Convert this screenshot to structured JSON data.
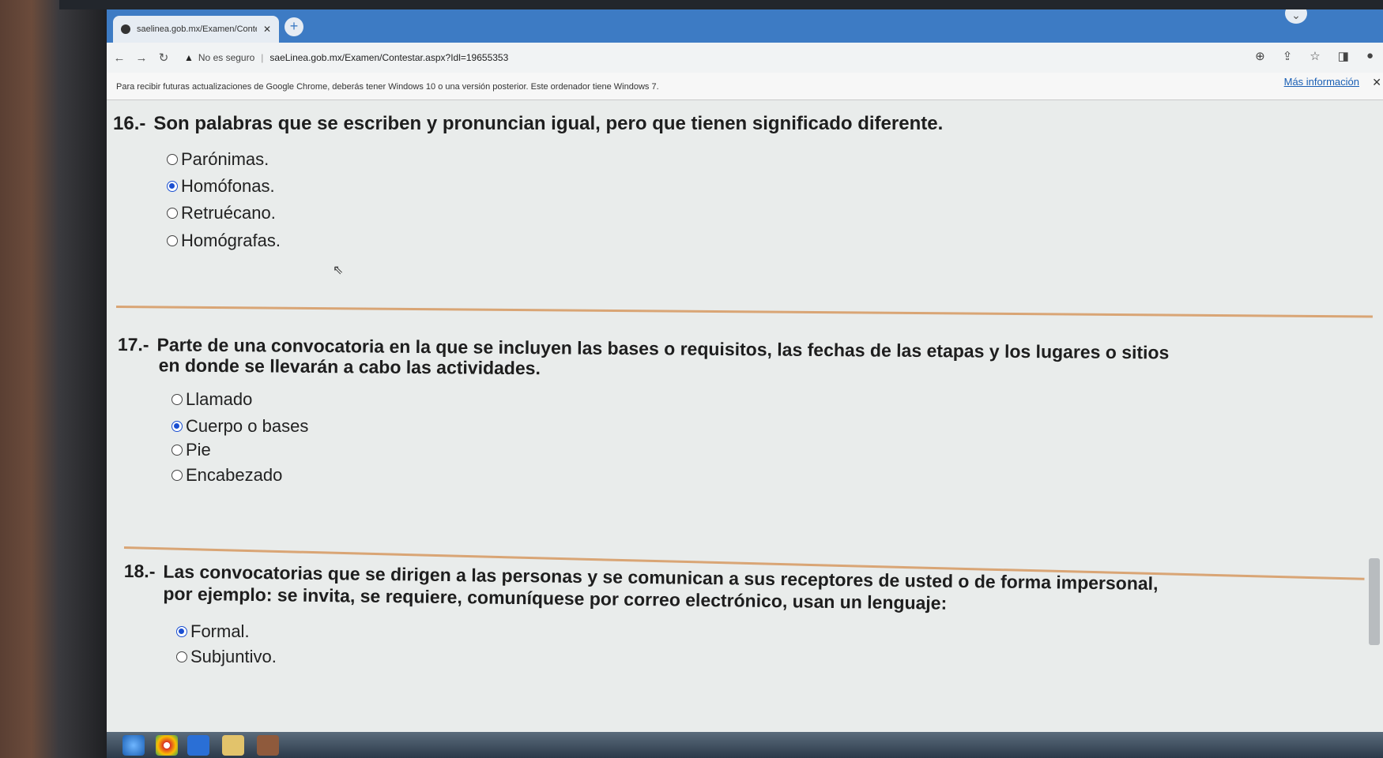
{
  "browser": {
    "tab_title": "saelinea.gob.mx/Examen/Conte",
    "insecure_label": "No es seguro",
    "url": "saeLinea.gob.mx/Examen/Contestar.aspx?Idl=19655353",
    "info_message": "Para recibir futuras actualizaciones de Google Chrome, deberás tener Windows 10 o una versión posterior. Este ordenador tiene Windows 7.",
    "info_link": "Más información"
  },
  "questions": [
    {
      "number": "16.-",
      "text": "Son palabras que se escriben y pronuncian igual, pero que tienen significado diferente.",
      "options": [
        {
          "label": "Parónimas.",
          "selected": false
        },
        {
          "label": "Homófonas.",
          "selected": true
        },
        {
          "label": "Retruécano.",
          "selected": false
        },
        {
          "label": "Homógrafas.",
          "selected": false
        }
      ]
    },
    {
      "number": "17.-",
      "text_line1": "Parte de una convocatoria en la que se incluyen las bases o requisitos, las fechas de las etapas y los lugares o sitios",
      "text_line2": "en donde se llevarán a cabo las actividades.",
      "options": [
        {
          "label": "Llamado",
          "selected": false
        },
        {
          "label": "Cuerpo o bases",
          "selected": true
        },
        {
          "label": "Pie",
          "selected": false
        },
        {
          "label": "Encabezado",
          "selected": false
        }
      ]
    },
    {
      "number": "18.-",
      "text_line1": "Las convocatorias que se dirigen a las personas y se comunican a sus receptores de usted o de forma impersonal,",
      "text_line2": "por ejemplo: se invita, se requiere, comuníquese por correo electrónico, usan un lenguaje:",
      "options": [
        {
          "label": "Formal.",
          "selected": true
        },
        {
          "label": "Subjuntivo.",
          "selected": false
        }
      ]
    }
  ],
  "icons": {
    "tab_favicon": "globe-icon",
    "new_tab": "plus-icon",
    "back": "arrow-left-icon",
    "forward": "arrow-right-icon",
    "reload": "reload-icon",
    "warning": "warning-icon",
    "zoom": "zoom-icon",
    "share": "share-icon",
    "bookmark": "star-icon",
    "sidebar": "sidebar-icon",
    "profile": "profile-icon"
  },
  "colors": {
    "titlebar": "#3d7bc4",
    "radio_selected": "#1a4fd1",
    "divider": "#d9a575",
    "link": "#1a5fb4"
  }
}
